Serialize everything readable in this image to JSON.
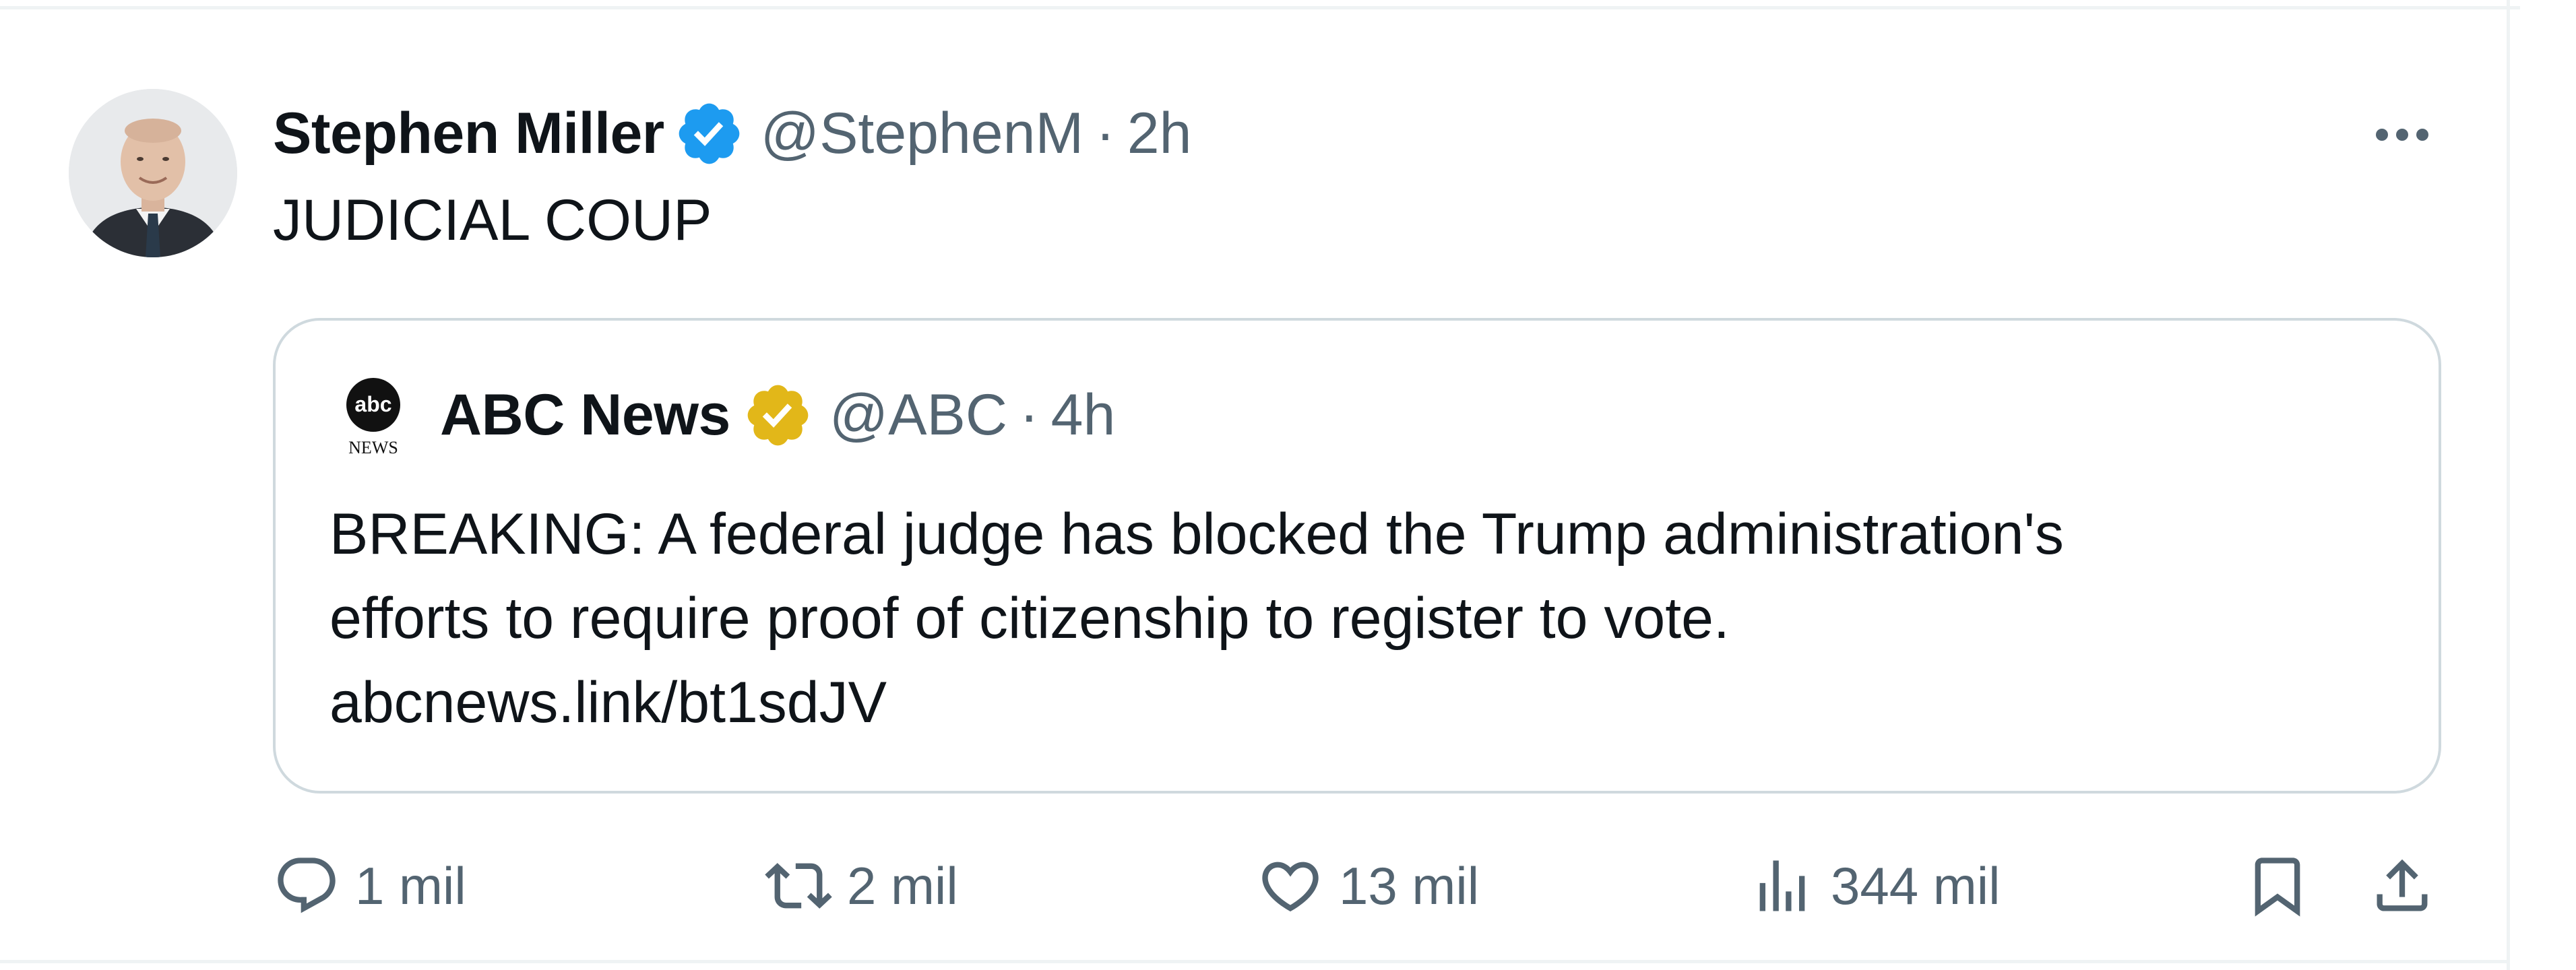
{
  "tweet": {
    "author": {
      "display_name": "Stephen Miller",
      "handle": "@StephenM",
      "separator": "·",
      "time": "2h",
      "verified_color": "#1d9bf0"
    },
    "text": "JUDICIAL COUP",
    "quoted": {
      "display_name": "ABC News",
      "handle": "@ABC",
      "separator": "·",
      "time": "4h",
      "verified_color": "#e2b719",
      "logo_text": "abc",
      "logo_caption": "NEWS",
      "lines": [
        "BREAKING: A federal judge has blocked the Trump administration's",
        "efforts to require proof of citizenship to register to vote.",
        "abcnews.link/bt1sdJV"
      ]
    },
    "actions": {
      "replies": "1 mil",
      "reposts": "2 mil",
      "likes": "13 mil",
      "views": "344 mil"
    },
    "icons": {
      "reply": "reply-icon",
      "repost": "repost-icon",
      "like": "heart-icon",
      "views": "views-icon",
      "bookmark": "bookmark-icon",
      "share": "share-icon",
      "more": "more-icon"
    }
  }
}
